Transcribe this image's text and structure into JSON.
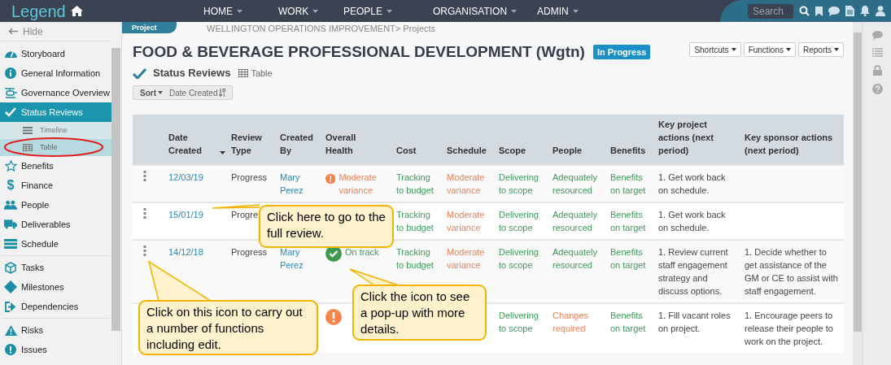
{
  "app": {
    "logo": "Legend"
  },
  "nav": [
    {
      "label": "HOME"
    },
    {
      "label": "WORK"
    },
    {
      "label": "PEOPLE"
    },
    {
      "label": "ORGANISATION"
    },
    {
      "label": "ADMIN"
    }
  ],
  "search": {
    "placeholder": "Search"
  },
  "sidebar": {
    "hide_label": "Hide",
    "sections": [
      [
        {
          "label": "Storyboard",
          "selected": false
        },
        {
          "label": "General Information",
          "selected": false
        },
        {
          "label": "Governance Overview",
          "selected": false
        },
        {
          "label": "Status Reviews",
          "selected": true,
          "children": [
            {
              "label": "Timeline",
              "selected": false
            },
            {
              "label": "Table",
              "selected": true
            }
          ]
        },
        {
          "label": "Benefits",
          "selected": false
        },
        {
          "label": "Finance",
          "selected": false,
          "glyph": "$"
        },
        {
          "label": "People",
          "selected": false
        },
        {
          "label": "Deliverables",
          "selected": false
        },
        {
          "label": "Schedule",
          "selected": false
        }
      ],
      [
        {
          "label": "Tasks",
          "selected": false
        },
        {
          "label": "Milestones",
          "selected": false
        },
        {
          "label": "Dependencies",
          "selected": false
        }
      ],
      [
        {
          "label": "Risks",
          "selected": false
        },
        {
          "label": "Issues",
          "selected": false
        }
      ]
    ]
  },
  "page": {
    "section_tab": "Project",
    "breadcrumb": "WELLINGTON OPERATIONS IMPROVEMENT> Projects",
    "title": "FOOD & BEVERAGE PROFESSIONAL DEVELOPMENT (Wgtn)",
    "status_badge": "In Progress",
    "buttons": [
      "Shortcuts",
      "Functions",
      "Reports"
    ],
    "subtitle": "Status Reviews",
    "view_label": "Table",
    "sort": {
      "label": "Sort",
      "field": "Date Created"
    }
  },
  "table": {
    "columns": [
      "Date Created",
      "Review Type",
      "Created By",
      "Overall Health",
      "Cost",
      "Schedule",
      "Scope",
      "People",
      "Benefits",
      "Key project actions (next period)",
      "Key sponsor actions (next period)"
    ],
    "rows": [
      {
        "actions_menu": true,
        "date": "12/03/19",
        "type": "Progress",
        "created_by": "Mary Perez",
        "health": {
          "kind": "warning",
          "text": "Moderate variance"
        },
        "cost": {
          "kind": "good",
          "text": "Tracking to budget"
        },
        "schedule": {
          "kind": "warning",
          "text": "Moderate variance"
        },
        "scope": {
          "kind": "good",
          "text": "Delivering to scope"
        },
        "people": {
          "kind": "good",
          "text": "Adequately resourced"
        },
        "benefits": {
          "kind": "good",
          "text": "Benefits on target"
        },
        "project_actions": "1. Get work back on schedule."
      },
      {
        "actions_menu": true,
        "date": "15/01/19",
        "type": "Progre",
        "cost": {
          "kind": "good",
          "text": "Tracking to budget"
        },
        "schedule": {
          "kind": "warning",
          "text": "Moderate variance"
        },
        "scope": {
          "kind": "good",
          "text": "Delivering to scope"
        },
        "people": {
          "kind": "good",
          "text": "Adequately resourced"
        },
        "benefits": {
          "kind": "good",
          "text": "Benefits on target"
        },
        "project_actions": "1. Get work back on schedule."
      },
      {
        "actions_menu": true,
        "date": "14/12/18",
        "type": "Progress",
        "created_by": "Mary Perez",
        "health": {
          "kind": "good",
          "text": "On track"
        },
        "cost": {
          "kind": "good",
          "text": "Tracking to budget"
        },
        "schedule": {
          "kind": "warning",
          "text": "Moderate variance"
        },
        "scope": {
          "kind": "good",
          "text": "Delivering to scope"
        },
        "people": {
          "kind": "good",
          "text": "Adequately resourced"
        },
        "benefits": {
          "kind": "good",
          "text": "Benefits on target"
        },
        "project_actions": "1. Review current staff engagement strategy and discuss options.",
        "sponsor_actions": "1. Decide whether to get assistance of the GM or CE to assist with staff engagement."
      },
      {
        "actions_menu": false,
        "health": {
          "kind": "warning"
        },
        "scope": {
          "kind": "good",
          "text": "Delivering to scope"
        },
        "people": {
          "kind": "warning",
          "text": "Changes required"
        },
        "benefits": {
          "kind": "good",
          "text": "Benefits on target"
        },
        "project_actions": "1. Fill vacant roles on project.",
        "sponsor_actions": "1. Encourage peers to release their people to work on the project."
      }
    ]
  },
  "callouts": [
    "Click here to go to the full review.",
    "Click on this icon to carry out a number of functions including edit.",
    "Click the icon to see  a pop-up with more details."
  ]
}
